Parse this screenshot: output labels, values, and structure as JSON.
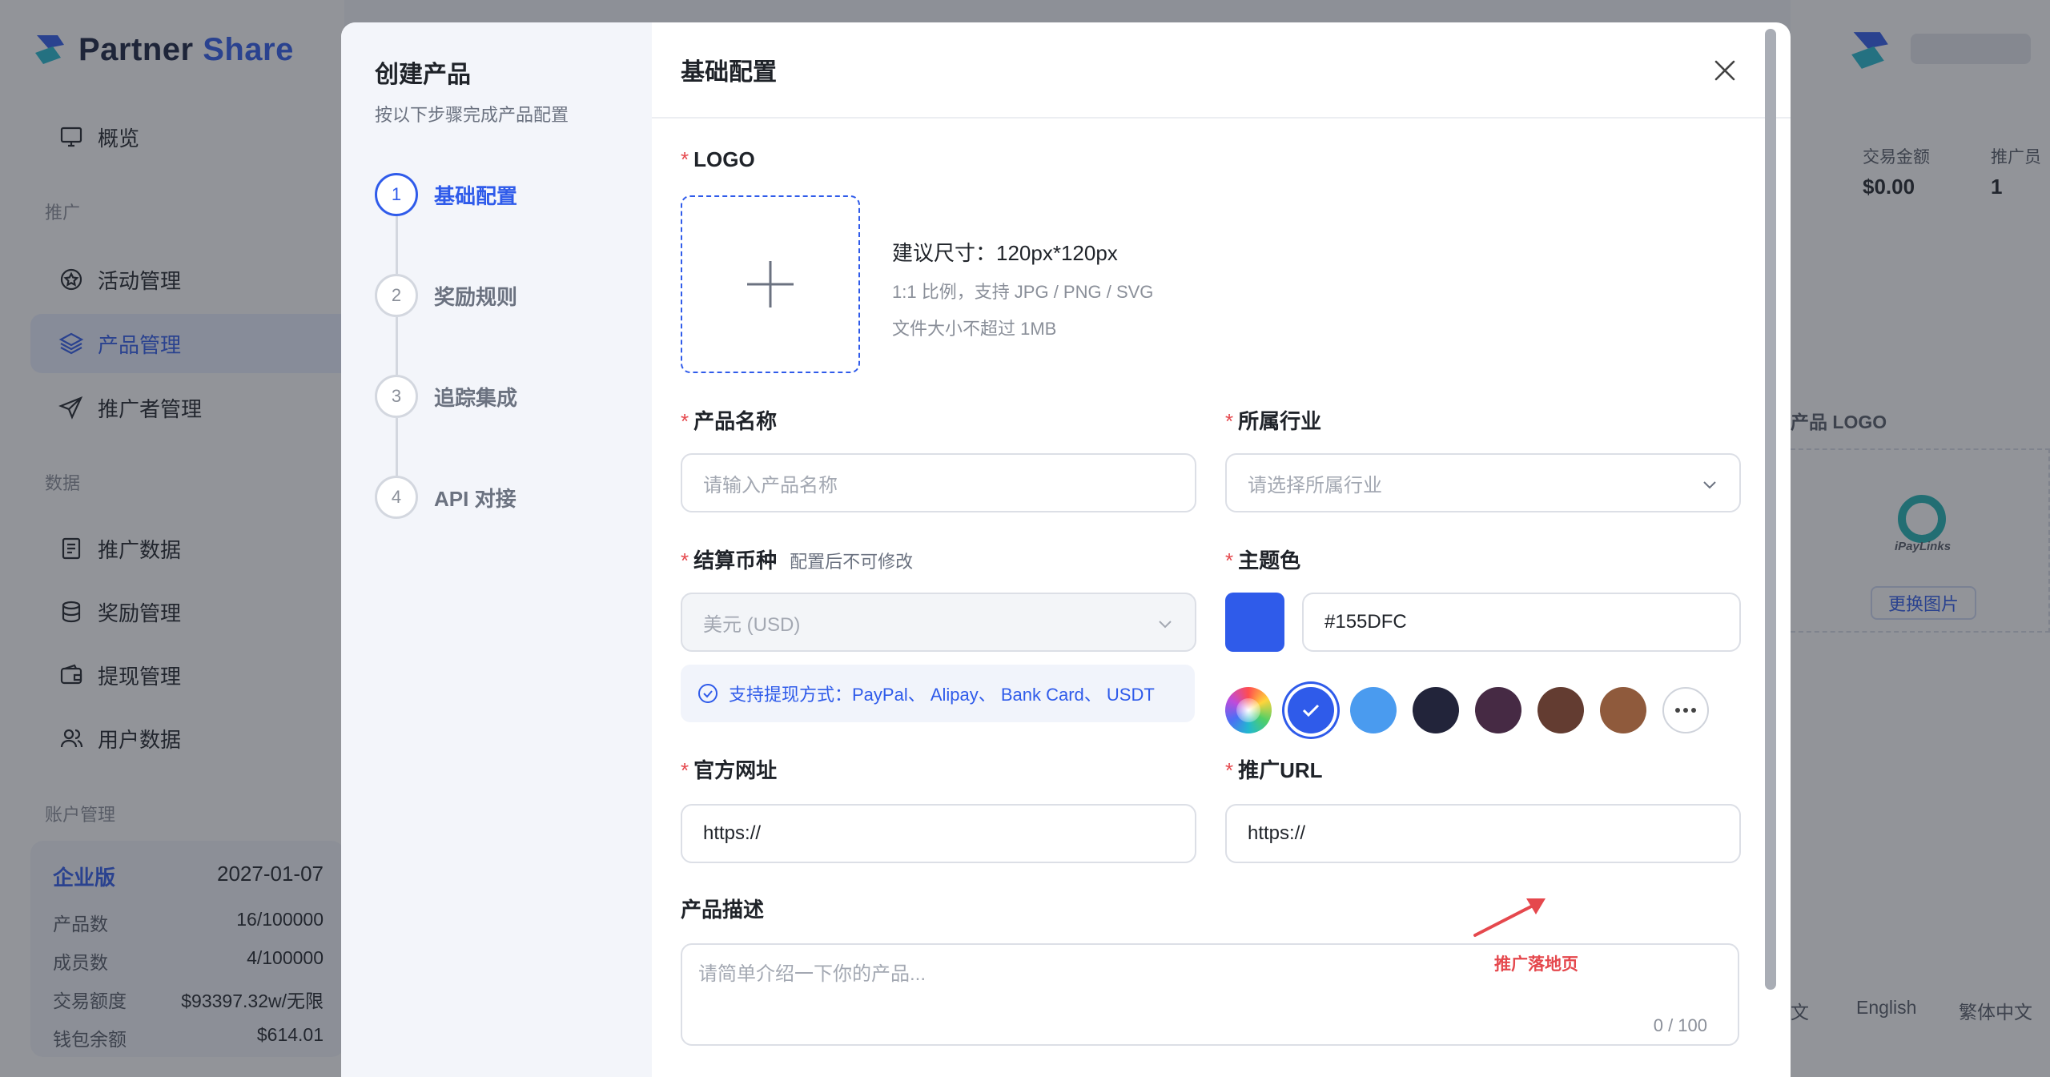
{
  "brand": {
    "name_part1": "Partner",
    "name_part2": "Share"
  },
  "sidebar": {
    "overview": "概览",
    "section_promo": "推广",
    "activity": "活动管理",
    "product": "产品管理",
    "promoter": "推广者管理",
    "section_data": "数据",
    "promo_data": "推广数据",
    "reward": "奖励管理",
    "withdraw": "提现管理",
    "user_data": "用户数据",
    "section_account": "账户管理"
  },
  "plan": {
    "tier": "企业版",
    "expiry": "2027-01-07",
    "rows": [
      {
        "label": "产品数",
        "value": "16/100000"
      },
      {
        "label": "成员数",
        "value": "4/100000"
      },
      {
        "label": "交易额度",
        "value": "$93397.32w/无限"
      },
      {
        "label": "钱包余额",
        "value": "$614.01"
      }
    ]
  },
  "bg_right": {
    "stat1_label": "交易金额",
    "stat1_value": "$0.00",
    "stat2_label": "推广员",
    "stat2_value": "1",
    "product_logo_label": "产品 LOGO",
    "logo_caption": "iPayLinks",
    "change_image": "更换图片",
    "lang_cn": "文",
    "lang_en": "English",
    "lang_tw": "繁体中文"
  },
  "modal": {
    "steps_title": "创建产品",
    "steps_sub": "按以下步骤完成产品配置",
    "steps": [
      {
        "num": "1",
        "label": "基础配置"
      },
      {
        "num": "2",
        "label": "奖励规则"
      },
      {
        "num": "3",
        "label": "追踪集成"
      },
      {
        "num": "4",
        "label": "API 对接"
      }
    ],
    "form_title": "基础配置",
    "logo_label": "LOGO",
    "logo_size": "建议尺寸：120px*120px",
    "logo_ratio": "1:1 比例，支持 JPG / PNG / SVG",
    "logo_filesize": "文件大小不超过 1MB",
    "product_name_label": "产品名称",
    "product_name_placeholder": "请输入产品名称",
    "industry_label": "所属行业",
    "industry_placeholder": "请选择所属行业",
    "currency_label": "结算币种",
    "currency_hint": "配置后不可修改",
    "currency_value": "美元 (USD)",
    "withdraw_notice": "支持提现方式：PayPal、 Alipay、 Bank Card、 USDT",
    "theme_label": "主题色",
    "theme_value": "#155DFC",
    "theme_color": "#2f5bea",
    "swatches": [
      "#2f5bea",
      "#4a9bef",
      "#22243a",
      "#462a44",
      "#633c31",
      "#8f5a3c"
    ],
    "website_label": "官方网址",
    "website_value": "https://",
    "promo_url_label": "推广URL",
    "promo_url_value": "https://",
    "desc_label": "产品描述",
    "desc_placeholder": "请简单介绍一下你的产品...",
    "desc_count": "0 / 100",
    "annotation": "推广落地页"
  }
}
